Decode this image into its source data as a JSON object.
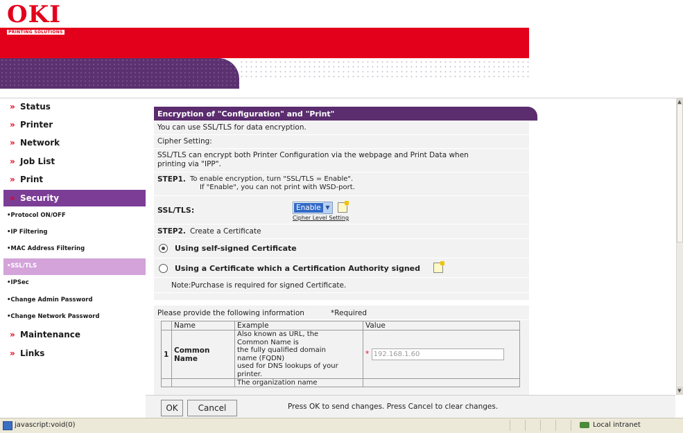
{
  "brand": {
    "name": "OKI",
    "tagline": "PRINTING SOLUTIONS"
  },
  "sidebar": {
    "items": [
      {
        "label": "Status",
        "chevron": "»"
      },
      {
        "label": "Printer",
        "chevron": "»"
      },
      {
        "label": "Network",
        "chevron": "»"
      },
      {
        "label": "Job List",
        "chevron": "»"
      },
      {
        "label": "Print",
        "chevron": "»"
      },
      {
        "label": "Security",
        "chevron": "»",
        "selected": true
      }
    ],
    "sub_items": [
      {
        "label": "•Protocol ON/OFF"
      },
      {
        "label": "•IP Filtering"
      },
      {
        "label": "•MAC Address Filtering"
      },
      {
        "label": "•SSL/TLS",
        "selected": true
      },
      {
        "label": "•IPSec"
      },
      {
        "label": "•Change Admin Password"
      },
      {
        "label": "•Change Network Password"
      }
    ],
    "after_items": [
      {
        "label": "Maintenance",
        "chevron": "»"
      },
      {
        "label": "Links",
        "chevron": "»"
      }
    ]
  },
  "panel": {
    "title": "Encryption of \"Configuration\" and \"Print\"",
    "intro": "You can use SSL/TLS for data encryption.",
    "cipher_label": "Cipher Setting:",
    "cipher_desc_1": "SSL/TLS can encrypt both Printer Configuration via the webpage and Print Data when",
    "cipher_desc_2": "printing via \"IPP\".",
    "step1_label": "STEP1.",
    "step1_text_1": "To enable encryption, turn \"SSL/TLS = Enable\".",
    "step1_text_2": "If \"Enable\", you can not print with WSD-port.",
    "ssl_label": "SSL/TLS:",
    "ssl_value": "Enable",
    "cipher_link": "Cipher Level Setting",
    "step2_label": "STEP2.",
    "step2_text": "Create a Certificate",
    "option_self": "Using self-signed Certificate",
    "option_ca": "Using a Certificate which a Certification Authority signed",
    "note": "Note:Purchase is required for signed Certificate.",
    "provide_text": "Please provide the following information",
    "required_text": "*Required"
  },
  "table": {
    "headers": [
      "Name",
      "Example",
      "Value"
    ],
    "row1": {
      "num": "1",
      "name": "Common Name",
      "example": [
        "Also known as URL, the",
        "Common Name is",
        "the fully qualified domain",
        "name (FQDN)",
        "used for DNS lookups of your",
        "printer."
      ],
      "required_mark": "*",
      "value": "192.168.1.60"
    },
    "row2_example": "The organization name"
  },
  "footer": {
    "ok_label": "OK",
    "cancel_label": "Cancel",
    "hint": "Press OK to send changes. Press Cancel to clear changes."
  },
  "statusbar": {
    "left_text": "javascript:void(0)",
    "zone_text": "Local intranet"
  },
  "colors": {
    "brand_red": "#e3001b",
    "purple": "#5b2d6e",
    "selected_purple": "#7b3d95",
    "selected_sub": "#d3a3da"
  },
  "icons": [
    "chevron-right-icon",
    "edit-note-icon",
    "radio-icon",
    "ie-page-icon",
    "intranet-icon"
  ]
}
